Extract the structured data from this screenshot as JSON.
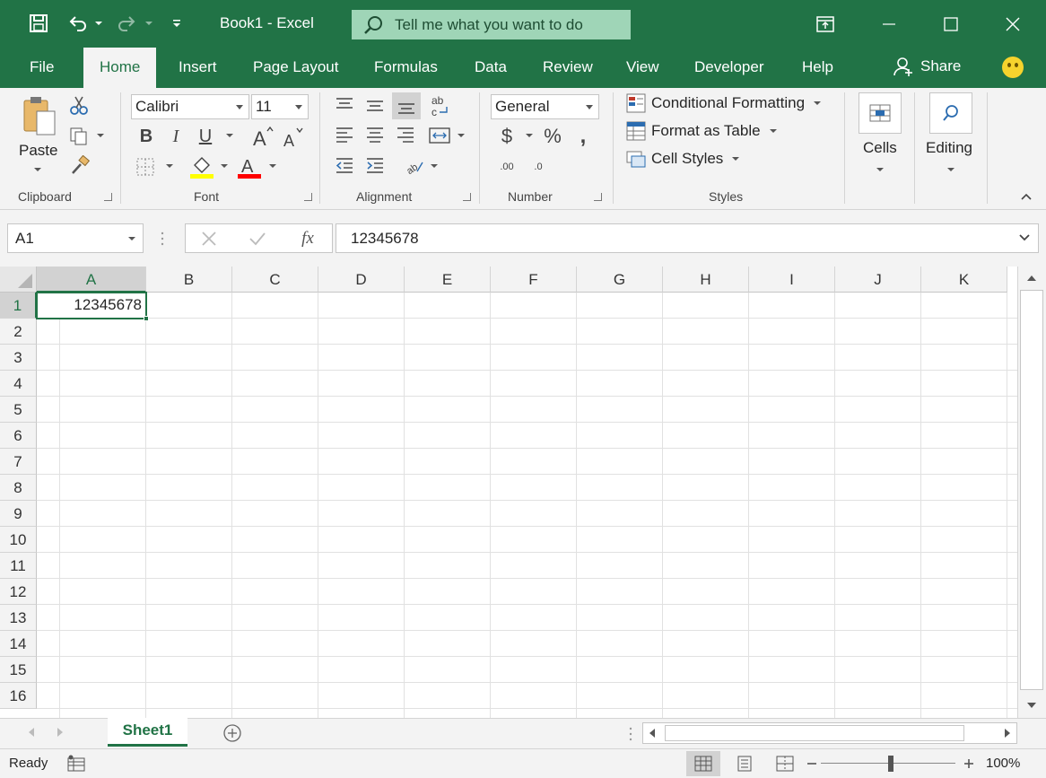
{
  "window": {
    "title": "Book1  -  Excel",
    "tell_me": "Tell me what you want to do"
  },
  "tabs": [
    "File",
    "Home",
    "Insert",
    "Page Layout",
    "Formulas",
    "Data",
    "Review",
    "View",
    "Developer",
    "Help"
  ],
  "active_tab": "Home",
  "share_label": "Share",
  "ribbon": {
    "clipboard": {
      "label": "Clipboard",
      "paste": "Paste"
    },
    "font": {
      "label": "Font",
      "name": "Calibri",
      "size": "11",
      "bold": "B",
      "italic": "I",
      "underline": "U",
      "fill_color": "#ffff00",
      "font_color": "#ff0000"
    },
    "alignment": {
      "label": "Alignment"
    },
    "number": {
      "label": "Number",
      "format": "General",
      "currency": "$",
      "percent": "%",
      "comma": ",",
      "inc_dec": ".00",
      "dec_dec": ".0"
    },
    "styles": {
      "label": "Styles",
      "conditional": "Conditional Formatting",
      "format_table": "Format as Table",
      "cell_styles": "Cell Styles"
    },
    "cells": {
      "label": "Cells"
    },
    "editing": {
      "label": "Editing"
    }
  },
  "formula_bar": {
    "name_box": "A1",
    "fx": "fx",
    "value": "12345678"
  },
  "grid": {
    "columns": [
      "A",
      "B",
      "C",
      "D",
      "E",
      "F",
      "G",
      "H",
      "I",
      "J",
      "K"
    ],
    "rows": [
      "1",
      "2",
      "3",
      "4",
      "5",
      "6",
      "7",
      "8",
      "9",
      "10",
      "11",
      "12",
      "13",
      "14",
      "15",
      "16"
    ],
    "selected_column": "A",
    "selected_row": "1",
    "a1_value": "12345678"
  },
  "sheets": [
    "Sheet1"
  ],
  "status": {
    "mode": "Ready",
    "zoom": "100%"
  },
  "colors": {
    "brand": "#217346",
    "ribbon_bg": "#f3f3f3"
  }
}
